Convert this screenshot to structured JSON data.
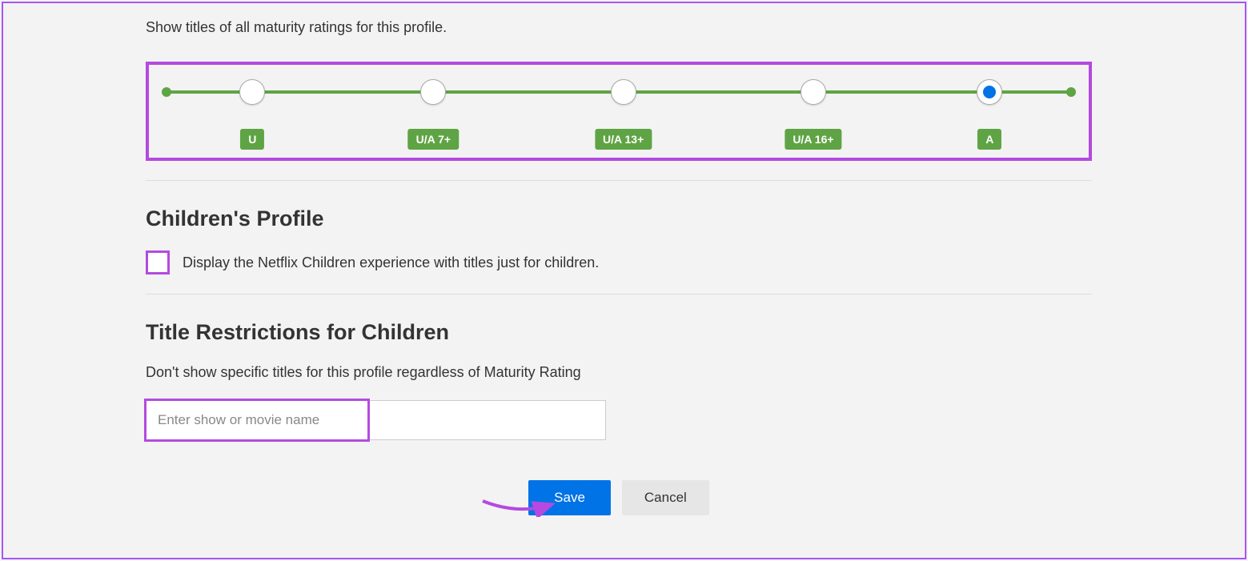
{
  "maturity": {
    "subtitle": "Show titles of all maturity ratings for this profile.",
    "steps": [
      {
        "label": "U",
        "pos": 9.5,
        "selected": false
      },
      {
        "label": "U/A 7+",
        "pos": 29.5,
        "selected": false
      },
      {
        "label": "U/A 13+",
        "pos": 50.5,
        "selected": false
      },
      {
        "label": "U/A 16+",
        "pos": 71.5,
        "selected": false
      },
      {
        "label": "A",
        "pos": 91.0,
        "selected": true
      }
    ]
  },
  "children_profile": {
    "heading": "Children's Profile",
    "checkbox_label": "Display the Netflix Children experience with titles just for children.",
    "checked": false
  },
  "title_restrictions": {
    "heading": "Title Restrictions for Children",
    "description": "Don't show specific titles for this profile regardless of Maturity Rating",
    "placeholder": "Enter show or movie name",
    "value": ""
  },
  "buttons": {
    "save": "Save",
    "cancel": "Cancel"
  },
  "colors": {
    "highlight": "#b44ae0",
    "slider": "#5fa444",
    "primary": "#0073e6"
  }
}
